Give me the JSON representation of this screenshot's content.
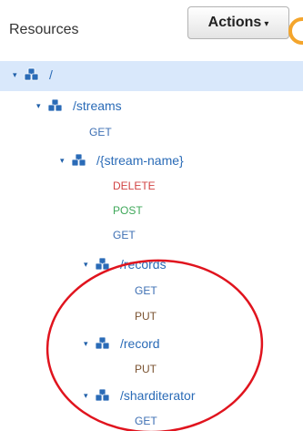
{
  "header": {
    "title": "Resources",
    "actions_label": "Actions",
    "caret": "▾"
  },
  "tree": {
    "root": {
      "path": "/"
    },
    "streams": {
      "path": "/streams",
      "method_get": "GET"
    },
    "stream_name": {
      "path": "/{stream-name}",
      "method_delete": "DELETE",
      "method_post": "POST",
      "method_get": "GET"
    },
    "records": {
      "path": "/records",
      "method_get": "GET",
      "method_put": "PUT"
    },
    "record": {
      "path": "/record",
      "method_put": "PUT"
    },
    "sharditerator": {
      "path": "/sharditerator",
      "method_get": "GET"
    }
  },
  "colors": {
    "selected_row": "#d9e8fb",
    "resource_link": "#2a6bb7",
    "get": "#3d6fb3",
    "put": "#7a5230",
    "delete": "#d24444",
    "post": "#3fa85a",
    "annotation_circle": "#e0141e"
  },
  "icons": {
    "expand": "▾",
    "resource": "resource-cubes-icon"
  }
}
